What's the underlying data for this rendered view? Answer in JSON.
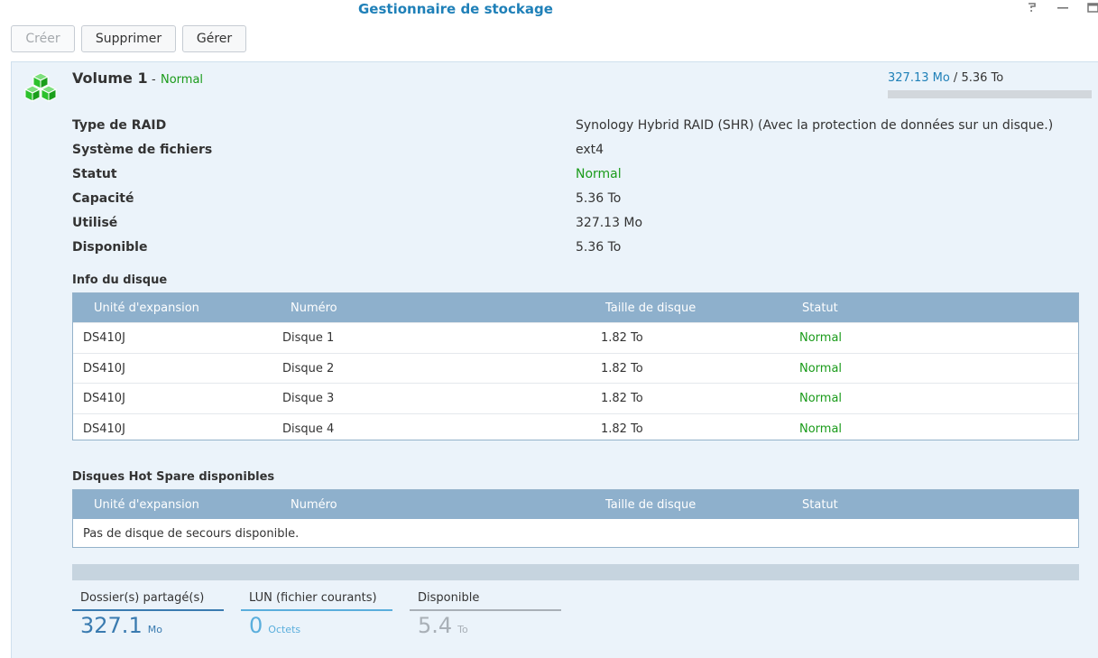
{
  "window": {
    "title": "Gestionnaire de stockage",
    "help_icon": "help-icon",
    "minimize_icon": "minimize-icon",
    "maximize_icon": "maximize-icon"
  },
  "toolbar": {
    "create_label": "Créer",
    "delete_label": "Supprimer",
    "manage_label": "Gérer"
  },
  "volume": {
    "name": "Volume 1",
    "separator": "-",
    "status": "Normal",
    "icon": "volume-cubes-icon",
    "usage_used": "327.13 Mo",
    "usage_sep": " / ",
    "usage_total": "5.36 To",
    "usage_fraction": 0.0001
  },
  "properties": [
    {
      "label": "Type de RAID",
      "value": "Synology Hybrid RAID (SHR) (Avec la protection de données sur un disque.)"
    },
    {
      "label": "Système de fichiers",
      "value": "ext4"
    },
    {
      "label": "Statut",
      "value": "Normal"
    },
    {
      "label": "Capacité",
      "value": "5.36 To"
    },
    {
      "label": "Utilisé",
      "value": "327.13 Mo"
    },
    {
      "label": "Disponible",
      "value": "5.36 To"
    }
  ],
  "disk_info": {
    "title": "Info du disque",
    "columns": [
      "Unité d'expansion",
      "Numéro",
      "Taille de disque",
      "Statut"
    ],
    "rows": [
      {
        "unit": "DS410J",
        "number": "Disque 1",
        "size": "1.82 To",
        "status": "Normal"
      },
      {
        "unit": "DS410J",
        "number": "Disque 2",
        "size": "1.82 To",
        "status": "Normal"
      },
      {
        "unit": "DS410J",
        "number": "Disque 3",
        "size": "1.82 To",
        "status": "Normal"
      },
      {
        "unit": "DS410J",
        "number": "Disque 4",
        "size": "1.82 To",
        "status": "Normal"
      }
    ]
  },
  "hot_spare": {
    "title": "Disques Hot Spare disponibles",
    "columns": [
      "Unité d'expansion",
      "Numéro",
      "Taille de disque",
      "Statut"
    ],
    "empty_message": "Pas de disque de secours disponible."
  },
  "stats": [
    {
      "label": "Dossier(s) partagé(s)",
      "value": "327.1",
      "unit": "Mo",
      "color": "#3a7bb0"
    },
    {
      "label": "LUN (fichier courants)",
      "value": "0",
      "unit": "Octets",
      "color": "#5aaedc"
    },
    {
      "label": "Disponible",
      "value": "5.4",
      "unit": "To",
      "color": "#a9b0b7"
    }
  ],
  "colors": {
    "accent": "#1f80b8",
    "status_ok": "#1a9b1a",
    "volume_icon": "#2cc12c",
    "grid_header": "#8eb0cc"
  }
}
